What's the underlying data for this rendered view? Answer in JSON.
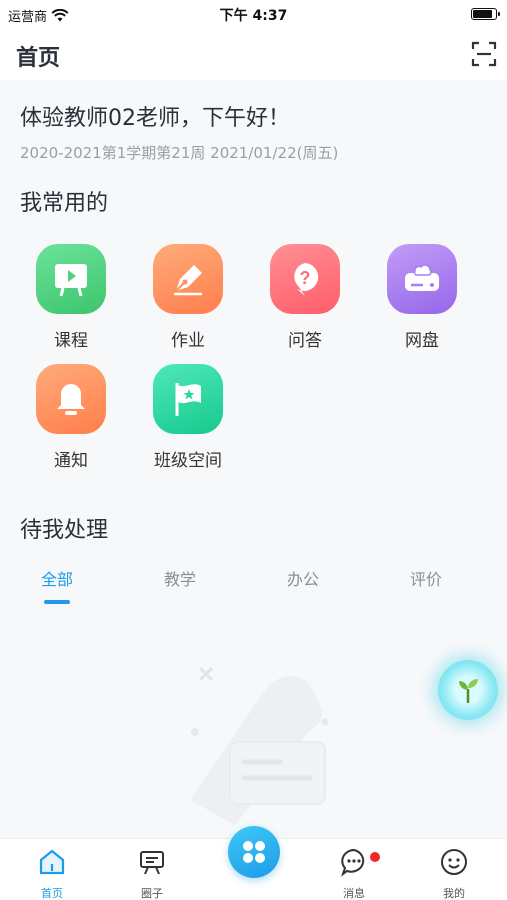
{
  "status_bar": {
    "carrier": "运营商",
    "time": "下午 4:37",
    "battery_level": 0.9
  },
  "nav": {
    "title": "首页",
    "scan_icon": "scan-icon"
  },
  "greeting": {
    "text": "体验教师02老师，下午好！",
    "date": "2020-2021第1学期第21周 2021/01/22(周五)"
  },
  "favorites": {
    "title": "我常用的",
    "items": [
      {
        "label": "课程",
        "icon": "course-icon",
        "color": "#4fd27c"
      },
      {
        "label": "作业",
        "icon": "homework-icon",
        "color": "#ff8f5c"
      },
      {
        "label": "问答",
        "icon": "question-icon",
        "color": "#ff6f78"
      },
      {
        "label": "网盘",
        "icon": "cloud-drive-icon",
        "color": "#a77df0"
      },
      {
        "label": "通知",
        "icon": "bell-icon",
        "color": "#ff8f5c"
      },
      {
        "label": "班级空间",
        "icon": "flag-icon",
        "color": "#28d7a0"
      }
    ]
  },
  "todo": {
    "title": "待我处理",
    "tabs": [
      "全部",
      "教学",
      "办公",
      "评价"
    ],
    "active_tab": "全部"
  },
  "tabbar": {
    "items": [
      {
        "label": "首页",
        "icon": "home-icon"
      },
      {
        "label": "圈子",
        "icon": "circle-board-icon"
      },
      {
        "label": "消息",
        "icon": "message-icon"
      },
      {
        "label": "我的",
        "icon": "profile-icon"
      }
    ],
    "active": "首页"
  },
  "colors": {
    "accent": "#1e9be8",
    "badge": "#f4262a"
  }
}
